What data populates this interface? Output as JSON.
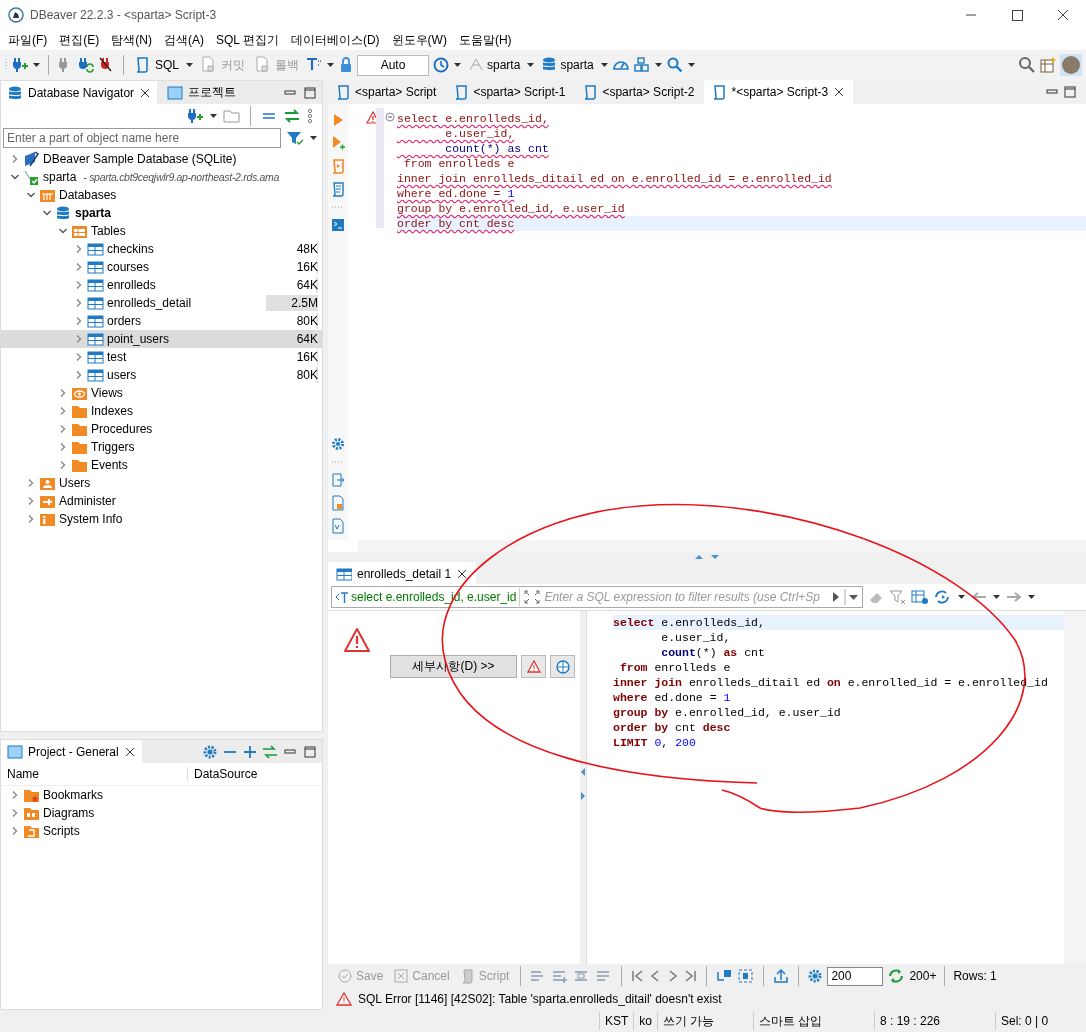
{
  "window": {
    "title": "DBeaver 22.2.3 - <sparta> Script-3"
  },
  "menu": [
    "파일(F)",
    "편집(E)",
    "탐색(N)",
    "검색(A)",
    "SQL 편집기",
    "데이터베이스(D)",
    "윈도우(W)",
    "도움말(H)"
  ],
  "toolbar": {
    "sql": "SQL",
    "commit": {
      "label": "커밋",
      "disabled": true
    },
    "rollback": {
      "label": "롤백",
      "disabled": true
    },
    "transaction_mode": "Auto",
    "datasource": "sparta",
    "schema": "sparta"
  },
  "navigator": {
    "tabs": [
      {
        "label": "Database Navigator",
        "selected": true
      },
      {
        "label": "프로젝트",
        "selected": false
      }
    ],
    "filter": {
      "placeholder": "Enter a part of object name here"
    },
    "tree": [
      {
        "label": "DBeaver Sample Database (SQLite)",
        "kind": "sqlite",
        "expanded": false,
        "selected": false
      },
      {
        "label": "sparta",
        "kind": "connection",
        "note": "- sparta.cbt9ceqjwlr9.ap-northeast-2.rds.ama",
        "expanded": true,
        "selected": false,
        "children": [
          {
            "label": "Databases",
            "kind": "databases",
            "expanded": true,
            "selected": false,
            "children": [
              {
                "label": "sparta",
                "kind": "database",
                "bold": true,
                "expanded": true,
                "selected": false,
                "children": [
                  {
                    "label": "Tables",
                    "kind": "tables",
                    "expanded": true,
                    "selected": false,
                    "children": [
                      {
                        "label": "checkins",
                        "kind": "table",
                        "size": "48K",
                        "level": 0.02,
                        "expanded": false,
                        "selected": false
                      },
                      {
                        "label": "courses",
                        "kind": "table",
                        "size": "16K",
                        "level": 0.01,
                        "expanded": false,
                        "selected": false
                      },
                      {
                        "label": "enrolleds",
                        "kind": "table",
                        "size": "64K",
                        "level": 0.03,
                        "expanded": false,
                        "selected": false
                      },
                      {
                        "label": "enrolleds_detail",
                        "kind": "table",
                        "size": "2.5M",
                        "level": 1,
                        "expanded": false,
                        "selected": false
                      },
                      {
                        "label": "orders",
                        "kind": "table",
                        "size": "80K",
                        "level": 0.03,
                        "expanded": false,
                        "selected": false
                      },
                      {
                        "label": "point_users",
                        "kind": "table",
                        "size": "64K",
                        "level": 0.03,
                        "expanded": false,
                        "selected": true
                      },
                      {
                        "label": "test",
                        "kind": "table",
                        "size": "16K",
                        "level": 0.01,
                        "expanded": false,
                        "selected": false
                      },
                      {
                        "label": "users",
                        "kind": "table",
                        "size": "80K",
                        "level": 0.03,
                        "expanded": false,
                        "selected": false
                      }
                    ]
                  },
                  {
                    "label": "Views",
                    "kind": "views",
                    "expanded": false,
                    "selected": false
                  },
                  {
                    "label": "Indexes",
                    "kind": "folder",
                    "expanded": false,
                    "selected": false
                  },
                  {
                    "label": "Procedures",
                    "kind": "folder",
                    "expanded": false,
                    "selected": false
                  },
                  {
                    "label": "Triggers",
                    "kind": "folder",
                    "expanded": false,
                    "selected": false
                  },
                  {
                    "label": "Events",
                    "kind": "folder",
                    "expanded": false,
                    "selected": false
                  }
                ]
              }
            ]
          },
          {
            "label": "Users",
            "kind": "users",
            "expanded": false,
            "selected": false
          },
          {
            "label": "Administer",
            "kind": "admin",
            "expanded": false,
            "selected": false
          },
          {
            "label": "System Info",
            "kind": "info",
            "expanded": false,
            "selected": false
          }
        ]
      }
    ]
  },
  "project": {
    "title": "Project - General",
    "columns": [
      "Name",
      "DataSource"
    ],
    "items": [
      {
        "label": "Bookmarks",
        "kind": "bookmarks",
        "expanded": false
      },
      {
        "label": "Diagrams",
        "kind": "diagrams",
        "expanded": false
      },
      {
        "label": "Scripts",
        "kind": "scripts",
        "expanded": false
      }
    ]
  },
  "editor": {
    "tabs": [
      {
        "label": "<sparta> Script",
        "selected": false
      },
      {
        "label": "<sparta> Script-1",
        "selected": false
      },
      {
        "label": "<sparta> Script-2",
        "selected": false
      },
      {
        "label": "*<sparta> Script-3",
        "selected": true
      }
    ],
    "lines": [
      {
        "squiggle": true,
        "current": false,
        "tokens": [
          {
            "kind": "error",
            "text": "select e.enrolleds_id,"
          }
        ]
      },
      {
        "squiggle": true,
        "current": false,
        "tokens": [
          {
            "kind": "error",
            "text": "       e.user_id,"
          }
        ]
      },
      {
        "squiggle": true,
        "current": false,
        "tokens": [
          {
            "kind": "function",
            "text": "       count(*) as cnt"
          }
        ]
      },
      {
        "squiggle": false,
        "current": false,
        "tokens": [
          {
            "kind": "error",
            "text": " from enrolleds e"
          }
        ]
      },
      {
        "squiggle": true,
        "current": false,
        "tokens": [
          {
            "kind": "error",
            "text": "inner join enrolleds_ditail ed on e.enrolled_id = e.enrolled_id"
          }
        ]
      },
      {
        "squiggle": true,
        "current": false,
        "tokens": [
          {
            "kind": "error",
            "text": "where ed.done = "
          },
          {
            "kind": "number",
            "text": "1"
          }
        ]
      },
      {
        "squiggle": true,
        "current": false,
        "tokens": [
          {
            "kind": "error",
            "text": "group by e.enrolled_id, e.user_id"
          }
        ]
      },
      {
        "squiggle": true,
        "current": true,
        "tokens": [
          {
            "kind": "error",
            "text": "order by cnt desc"
          }
        ]
      }
    ]
  },
  "results": {
    "tab": "enrolleds_detail 1",
    "query": "select e.enrolleds_id, e.user_id",
    "filter": {
      "placeholder": "Enter a SQL expression to filter results (use Ctrl+Sp"
    },
    "details_button": "세부사항(D) >>",
    "lines": [
      {
        "current": true,
        "tokens": [
          {
            "kind": "keyword",
            "text": "select"
          },
          {
            "kind": "plain",
            "text": " e.enrolleds_id,"
          }
        ]
      },
      {
        "current": false,
        "tokens": [
          {
            "kind": "plain",
            "text": "       e.user_id,"
          }
        ]
      },
      {
        "current": false,
        "tokens": [
          {
            "kind": "function",
            "text": "       count"
          },
          {
            "kind": "plain",
            "text": "(*) "
          },
          {
            "kind": "keyword",
            "text": "as"
          },
          {
            "kind": "plain",
            "text": " cnt"
          }
        ]
      },
      {
        "current": false,
        "tokens": [
          {
            "kind": "keyword",
            "text": " from"
          },
          {
            "kind": "plain",
            "text": " enrolleds e"
          }
        ]
      },
      {
        "current": false,
        "tokens": [
          {
            "kind": "keyword",
            "text": "inner join"
          },
          {
            "kind": "plain",
            "text": " enrolleds_ditail ed "
          },
          {
            "kind": "keyword",
            "text": "on"
          },
          {
            "kind": "plain",
            "text": " e.enrolled_id = e.enrolled_id"
          }
        ]
      },
      {
        "current": false,
        "tokens": [
          {
            "kind": "keyword",
            "text": "where"
          },
          {
            "kind": "plain",
            "text": " ed.done = "
          },
          {
            "kind": "number",
            "text": "1"
          }
        ]
      },
      {
        "current": false,
        "tokens": [
          {
            "kind": "keyword",
            "text": "group by"
          },
          {
            "kind": "plain",
            "text": " e.enrolled_id, e.user_id"
          }
        ]
      },
      {
        "current": false,
        "tokens": [
          {
            "kind": "keyword",
            "text": "order by"
          },
          {
            "kind": "plain",
            "text": " cnt "
          },
          {
            "kind": "keyword",
            "text": "desc"
          }
        ]
      },
      {
        "current": false,
        "tokens": [
          {
            "kind": "keyword",
            "text": "LIMIT"
          },
          {
            "kind": "number",
            "text": " 0"
          },
          {
            "kind": "plain",
            "text": ", "
          },
          {
            "kind": "number",
            "text": "200"
          }
        ]
      }
    ],
    "actions": [
      {
        "label": "Save",
        "kind": "save",
        "disabled": true
      },
      {
        "label": "Cancel",
        "kind": "cancel",
        "disabled": true
      },
      {
        "label": "Script",
        "kind": "script",
        "disabled": true
      }
    ],
    "fetch_size": "200",
    "fetch_more": "200+",
    "rows": "Rows: 1",
    "error": "SQL Error [1146] [42S02]: Table 'sparta.enrolleds_ditail' doesn't exist"
  },
  "status_bar": [
    "KST",
    "ko",
    "쓰기 가능",
    "스마트 삽입",
    "8 : 19 : 226",
    "Sel: 0 | 0"
  ]
}
